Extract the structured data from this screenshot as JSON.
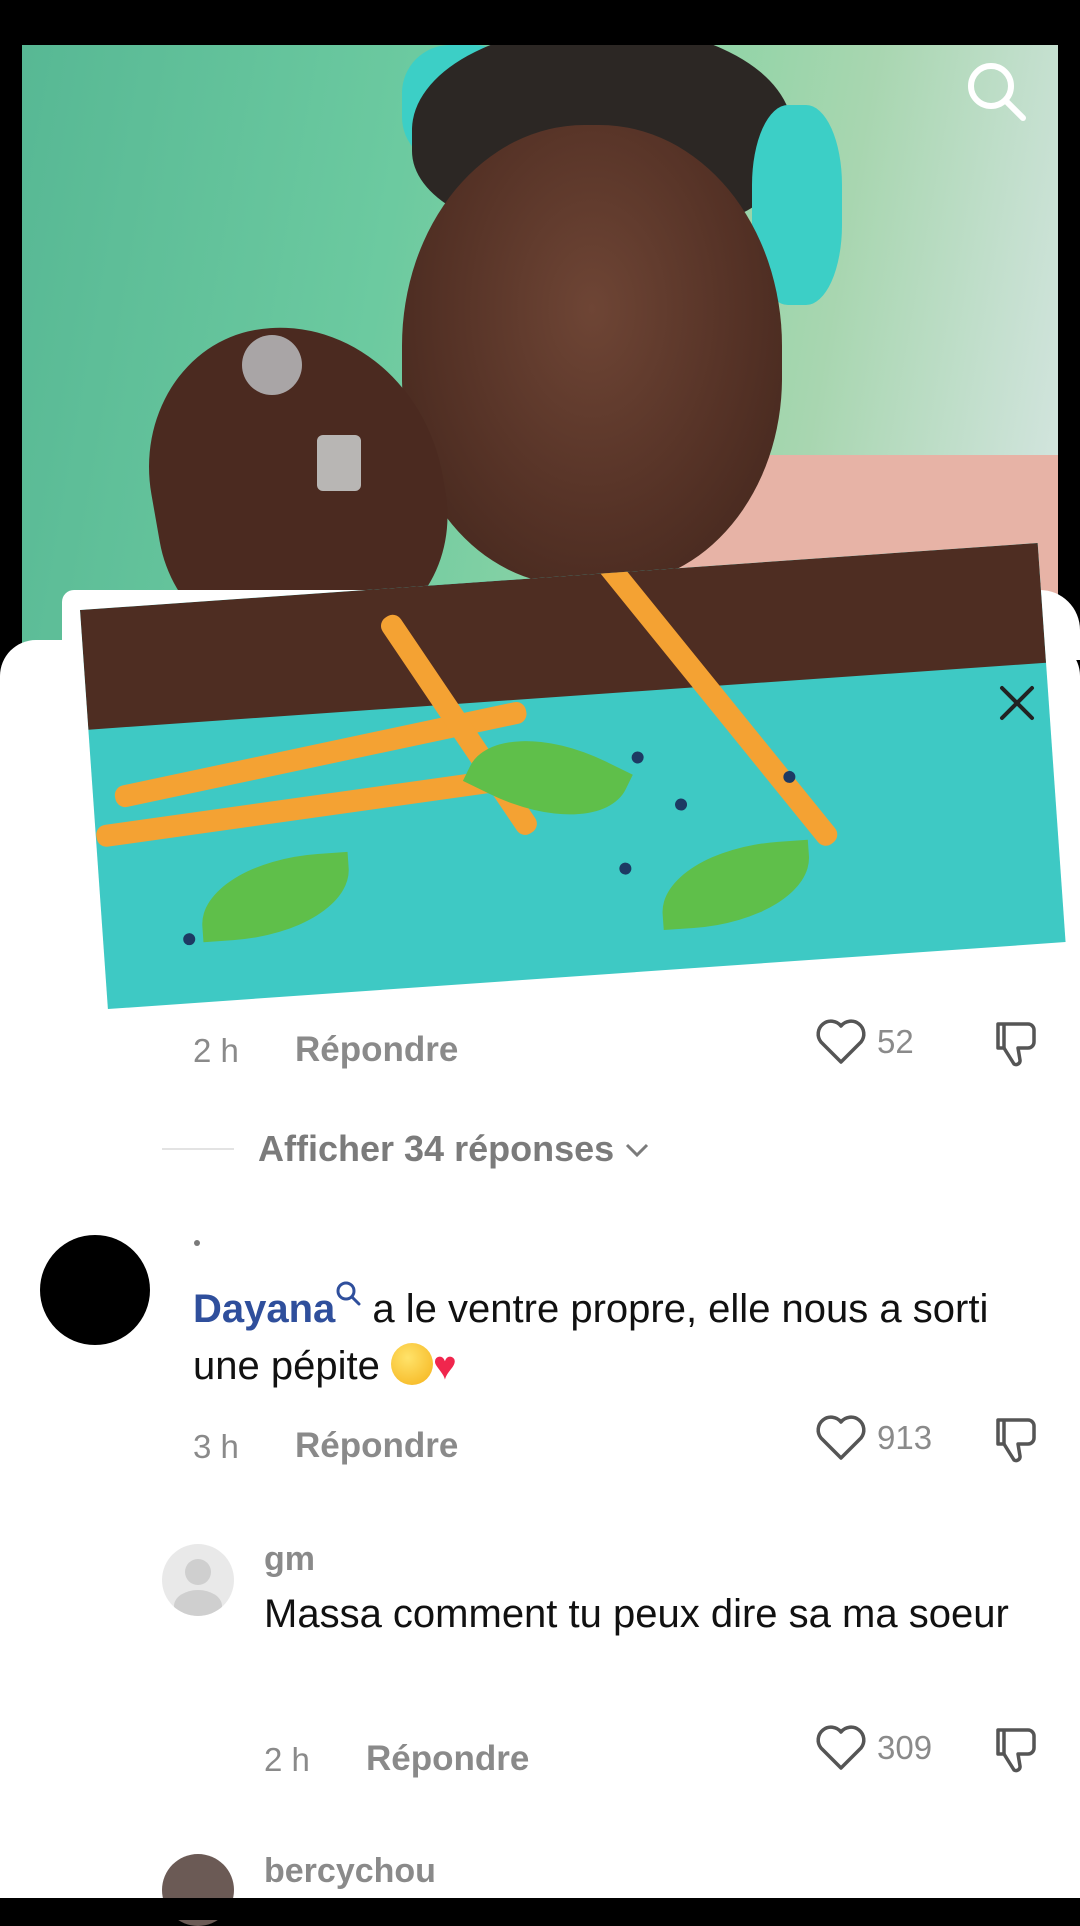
{
  "comments": [
    {
      "time": "2 h",
      "reply_label": "Répondre",
      "likes": "52"
    },
    {
      "view_replies": "Afficher 34 réponses",
      "username": ".",
      "mention": "Dayana",
      "text": " a le ventre propre, elle nous a sorti une pépite ",
      "time": "3 h",
      "reply_label": "Répondre",
      "likes": "913"
    },
    {
      "username": "gm",
      "text": "Massa comment tu peux dire sa ma soeur",
      "time": "2 h",
      "reply_label": "Répondre",
      "likes": "309"
    },
    {
      "username": "bercychou"
    }
  ],
  "colors": {
    "mention": "#2f4f9c",
    "secondary_text": "#8a8a8a"
  },
  "icons": [
    "search-icon",
    "close-icon",
    "heart-icon",
    "dislike-icon"
  ]
}
